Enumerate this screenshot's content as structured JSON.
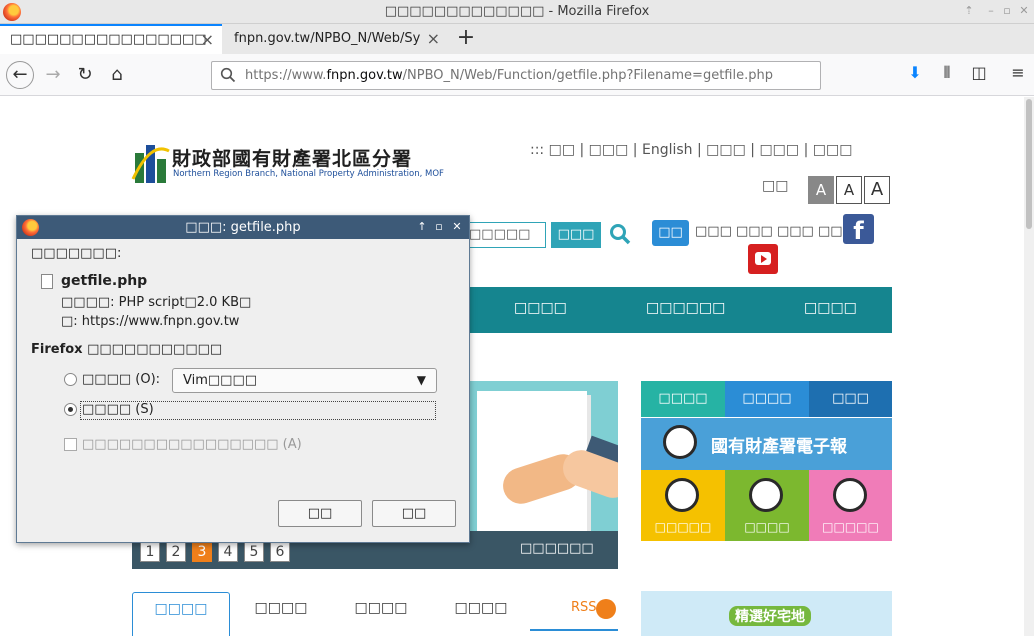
{
  "window": {
    "title": "□□□□□□□□□□□□□ - Mozilla Firefox"
  },
  "tabs": [
    {
      "label": "□□□□□□□□□□□□□□□□",
      "active": true
    },
    {
      "label": "fnpn.gov.tw/NPBO_N/Web/Sy",
      "active": false
    }
  ],
  "urlbar": {
    "prefix": "https://www.",
    "domain": "fnpn.gov.tw",
    "path": "/NPBO_N/Web/Function/getfile.php?Filename=getfile.php"
  },
  "site": {
    "logo_zh": "財政部國有財產署北區分署",
    "logo_en": "Northern Region Branch, National Property Administration, MOF",
    "toplinks": "::: □□ | □□□ | English | □□□ | □□□ | □□□",
    "fontsize_label": "□□",
    "font_buttons": [
      "A",
      "A",
      "A"
    ],
    "search_value": "□□□□□",
    "search_button": "□□□",
    "pill": "□□",
    "sublinks": "□□□ □□□ □□□ □□□",
    "facebook": "f",
    "menu": [
      "□□□□",
      "□□□□□□",
      "□□□□"
    ],
    "carousel_pages": [
      "1",
      "2",
      "3",
      "4",
      "5",
      "6"
    ],
    "carousel_active": "3",
    "banner_caption": "□□□□□□",
    "tiles": [
      "□□□□",
      "□□□□",
      "□□□"
    ],
    "enews": "國有財產署電子報",
    "lowtiles": [
      "□□□□□",
      "□□□□",
      "□□□□□"
    ],
    "news_tabs": [
      "□□□□",
      "□□□□",
      "□□□□",
      "□□□□"
    ],
    "rss": "RSS",
    "housing": "精選好宅地"
  },
  "dialog": {
    "title": "□□□: getfile.php",
    "intro": "□□□□□□□:",
    "filename": "getfile.php",
    "type_line": "□□□□: PHP script□2.0 KB□",
    "from_line": "□: https://www.fnpn.gov.tw",
    "question_prefix": "Firefox",
    "question": "□□□□□□□□□□□",
    "open_with_label": "□□□□ (O):",
    "open_with_value": "Vim□□□□",
    "save_label": "□□□□ (S)",
    "remember_label": "□□□□□□□□□□□□□□□□ (A)",
    "ok_button": "□□",
    "cancel_button": "□□"
  }
}
